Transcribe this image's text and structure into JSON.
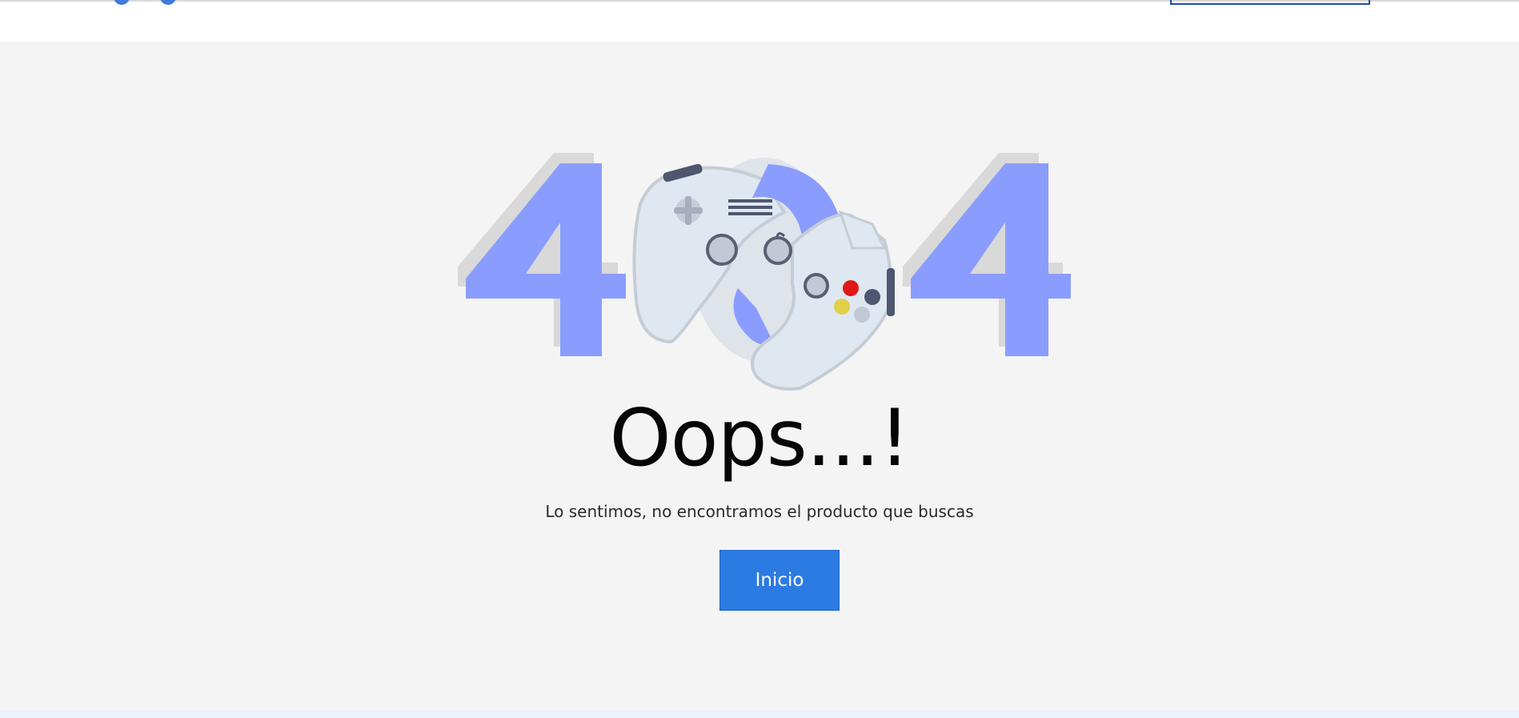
{
  "main": {
    "error_code": "404",
    "title": "Oops...!",
    "message": "Lo sentimos, no encontramos el producto que buscas",
    "home_button_label": "Inicio"
  },
  "colors": {
    "digit": "#8a9dff",
    "digit_shadow": "#d9d9d9",
    "button": "#2b7be3",
    "background": "#f4f4f4",
    "controller_body": "#dfe8f0"
  },
  "icons": {
    "illustration": "gamepad-controllers-icon"
  }
}
